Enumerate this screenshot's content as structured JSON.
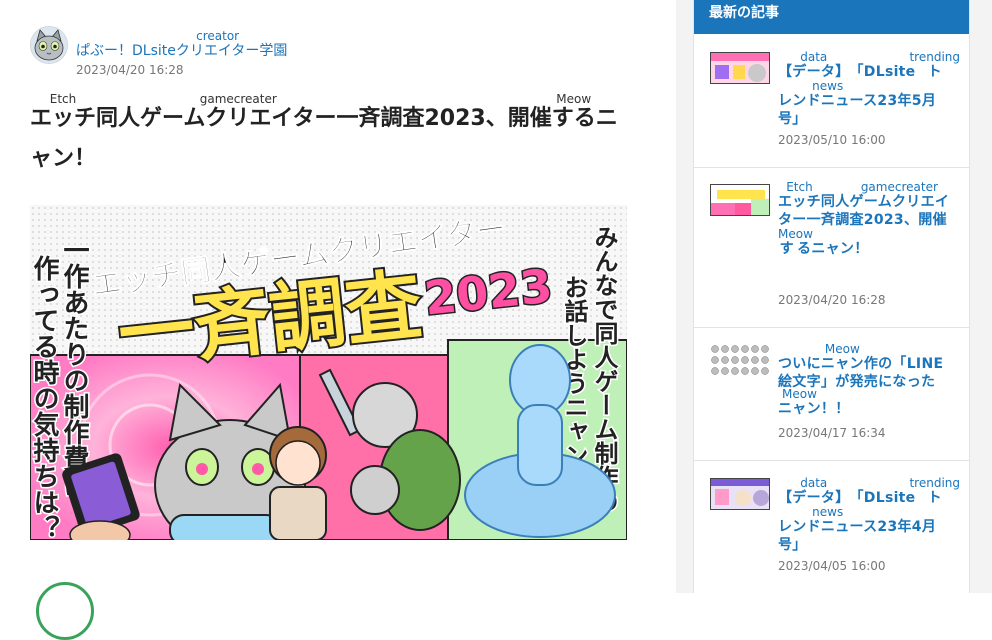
{
  "article": {
    "author": {
      "name_prefix": "ぱぶー！DLsite",
      "name_ruby_base": "クリエイター",
      "name_ruby_text": "creator",
      "name_suffix": "学園",
      "date": "2023/04/20 16:28"
    },
    "title": {
      "seg1_base": "エッチ",
      "seg1_ruby": "Etch",
      "seg2": "同人",
      "seg3_base": "ゲームクリエイター",
      "seg3_ruby": "gamecreater",
      "seg4": "一斉調査2023、開催",
      "seg5_base": "する",
      "seg5_ruby": "Meow",
      "seg6": "ニャン！"
    },
    "hero": {
      "top_text": "エッチ同人ゲームクリエイター",
      "big_text": "一斉調査",
      "year": "2023",
      "left_vertical_1": "一作あたりの制作費は？",
      "left_vertical_2": "作ってる時の気持ちは？",
      "right_vertical_1": "みんなで同人ゲーム制作の",
      "right_vertical_2": "お話しようニャン！"
    }
  },
  "sidebar": {
    "heading": "最新の記事",
    "posts": [
      {
        "t1_base": "【データ】",
        "t1_ruby": "data",
        "t2": "「DLsite",
        "t3_base": "トレンドニュース",
        "t3_ruby": "trending news",
        "t4": "23年5月号」",
        "date": "2023/05/10 16:00"
      },
      {
        "t1_base": "エッチ",
        "t1_ruby": "Etch",
        "t2": "同人",
        "t3_base": "ゲームクリエイター",
        "t3_ruby": "gamecreater",
        "t4": "一斉調査2023、開催",
        "t5_base": "する",
        "t5_ruby": "Meow",
        "t6": "ニャン！",
        "date": "2023/04/20 16:28"
      },
      {
        "t1_base": "ついに",
        "t1_ruby": "",
        "t2_base": "ニャン",
        "t2_ruby": "Meow",
        "t3": "作の「LINE絵文字」が発売になった",
        "t4_base": "ニャン",
        "t4_ruby": "Meow",
        "t5": "！！",
        "date": "2023/04/17 16:34"
      },
      {
        "t1_base": "【データ】",
        "t1_ruby": "data",
        "t2": "「DLsite",
        "t3_base": "トレンドニュース",
        "t3_ruby": "trending news",
        "t4": "23年4月号」",
        "date": "2023/04/05 16:00"
      }
    ]
  },
  "colors": {
    "accent": "#1b75bb",
    "text": "#222222",
    "muted": "#777777",
    "pink": "#e83e8c"
  }
}
